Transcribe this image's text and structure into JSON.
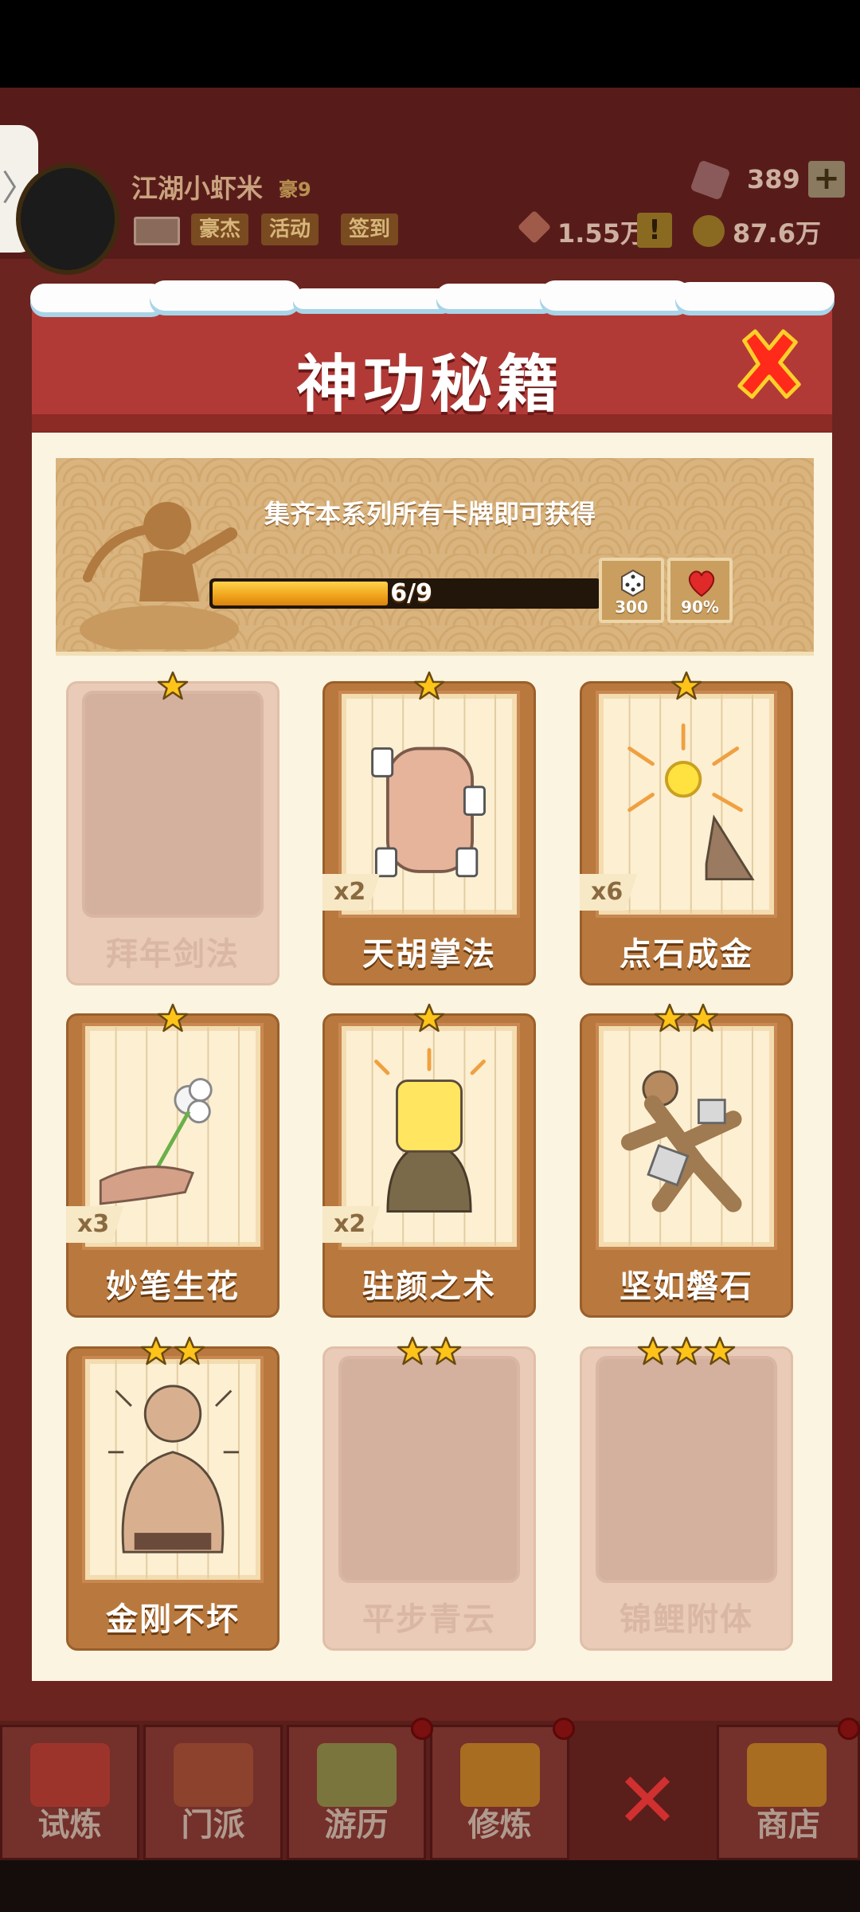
{
  "header": {
    "player_name": "江湖小虾米",
    "player_title": "豪9",
    "buttons": [
      "豪杰",
      "活动",
      "签到"
    ],
    "gems": "389",
    "power": "1.55万",
    "coins": "87.6万",
    "alert": "!",
    "plus": "+",
    "side_tab": "〉"
  },
  "modal": {
    "title": "神功秘籍",
    "banner_text": "集齐本系列所有卡牌即可获得",
    "progress": {
      "text": "6/9",
      "collected": 6,
      "total": 9
    },
    "rewards": [
      {
        "icon": "dice-icon",
        "label": "300"
      },
      {
        "icon": "heart-icon",
        "label": "90%"
      }
    ],
    "cards": [
      {
        "name": "拜年剑法",
        "stars": 1,
        "multiplier": "",
        "collected": false,
        "art": "locked"
      },
      {
        "name": "天胡掌法",
        "stars": 1,
        "multiplier": "x2",
        "collected": true,
        "art": "palm"
      },
      {
        "name": "点石成金",
        "stars": 1,
        "multiplier": "x6",
        "collected": true,
        "art": "gold"
      },
      {
        "name": "妙笔生花",
        "stars": 1,
        "multiplier": "x3",
        "collected": true,
        "art": "flower"
      },
      {
        "name": "驻颜之术",
        "stars": 1,
        "multiplier": "x2",
        "collected": true,
        "art": "mask"
      },
      {
        "name": "坚如磐石",
        "stars": 2,
        "multiplier": "",
        "collected": true,
        "art": "rock"
      },
      {
        "name": "金刚不坏",
        "stars": 2,
        "multiplier": "",
        "collected": true,
        "art": "muscle"
      },
      {
        "name": "平步青云",
        "stars": 2,
        "multiplier": "",
        "collected": false,
        "art": "locked"
      },
      {
        "name": "锦鲤附体",
        "stars": 3,
        "multiplier": "",
        "collected": false,
        "art": "locked"
      }
    ]
  },
  "bottom_nav": [
    {
      "label": "试炼",
      "art_color": "#c0392b"
    },
    {
      "label": "门派",
      "art_color": "#a0522d"
    },
    {
      "label": "游历",
      "art_color": "#7fae4a"
    },
    {
      "label": "修炼",
      "art_color": "#d4a017"
    },
    {
      "label": "",
      "art_color": ""
    },
    {
      "label": "商店",
      "art_color": "#d4a017"
    }
  ],
  "colors": {
    "modal_red": "#b23a36",
    "card_brown": "#b9793e",
    "progress_gold": "#f0a21c"
  }
}
